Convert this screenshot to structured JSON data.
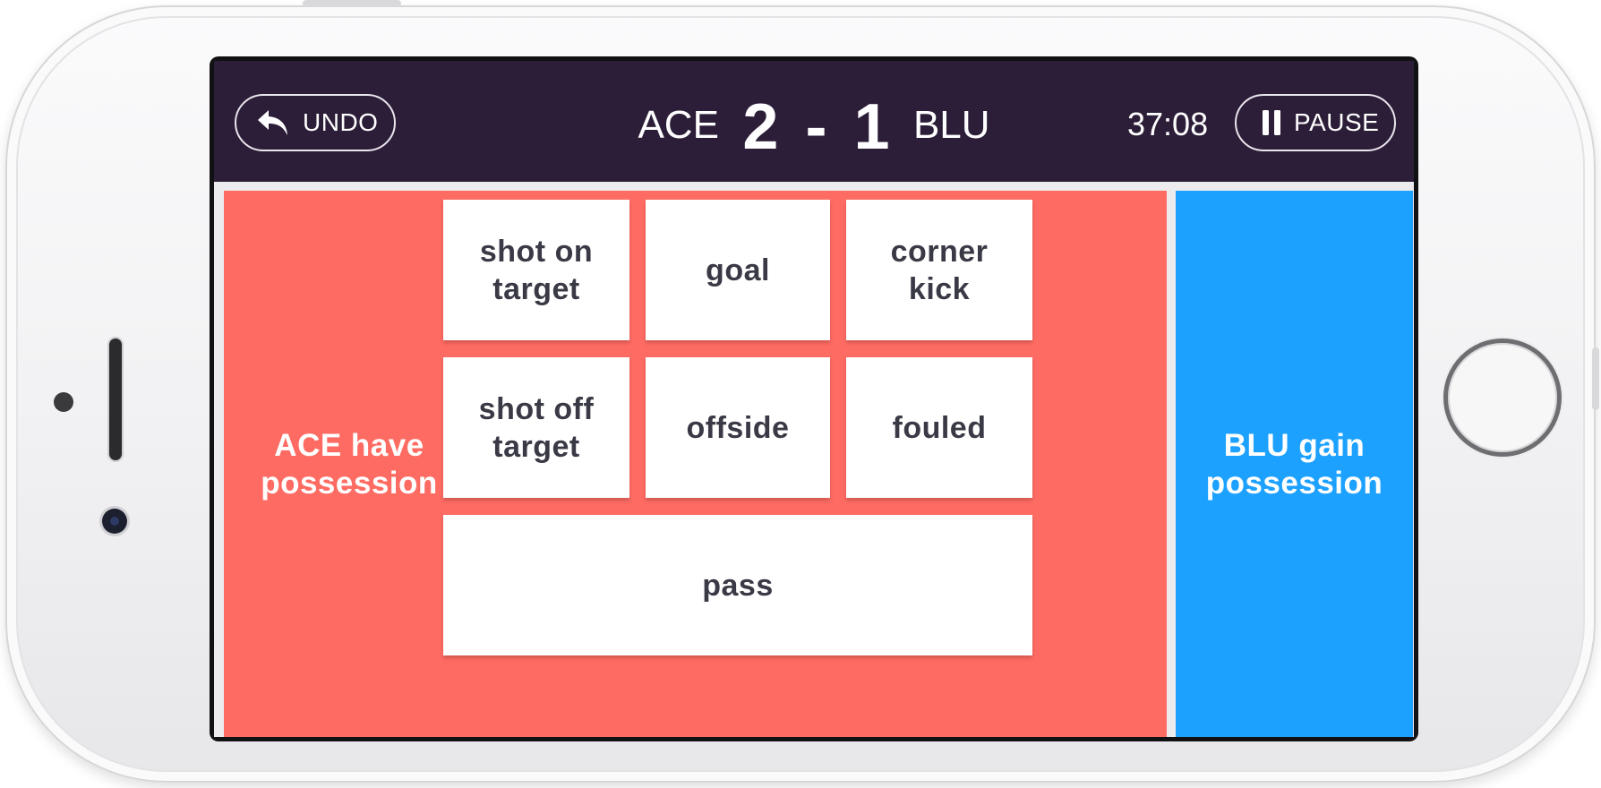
{
  "topbar": {
    "undo_label": "UNDO",
    "home_team": "ACE",
    "home_score": "2",
    "score_separator": "-",
    "away_score": "1",
    "away_team": "BLU",
    "clock": "37:08",
    "pause_label": "PAUSE"
  },
  "panels": {
    "ace_possession_label": "ACE have possession",
    "blu_possession_label": "BLU gain possession"
  },
  "events": {
    "shot_on_target": "shot on target",
    "goal": "goal",
    "corner_kick": "corner kick",
    "shot_off_target": "shot off target",
    "offside": "offside",
    "fouled": "fouled",
    "pass": "pass"
  },
  "icons": {
    "undo": "undo-arrow-icon",
    "pause": "pause-icon"
  },
  "colors": {
    "topbar": "#2c1e38",
    "ace": "#fe6b63",
    "blu": "#1da1ff",
    "button_text": "#3a3a46"
  }
}
